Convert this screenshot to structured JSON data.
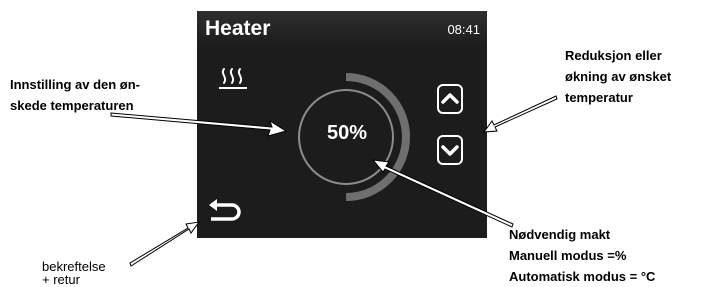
{
  "screen": {
    "title": "Heater",
    "time": "08:41",
    "value": "50%",
    "level": 0.5,
    "icons": {
      "heat": "heat-waves-icon",
      "up": "chevron-up-icon",
      "down": "chevron-down-icon",
      "back": "return-arrow-icon"
    }
  },
  "annotations": {
    "setting": [
      "Innstilling av den øn-",
      "skede temperaturen"
    ],
    "adjust": [
      "Reduksjon eller",
      "økning av ønsket",
      "temperatur"
    ],
    "power": [
      "Nødvendig makt",
      "Manuell modus =%",
      "Automatisk modus = °C"
    ],
    "confirm": [
      "bekreftelse",
      "+ retur"
    ]
  }
}
